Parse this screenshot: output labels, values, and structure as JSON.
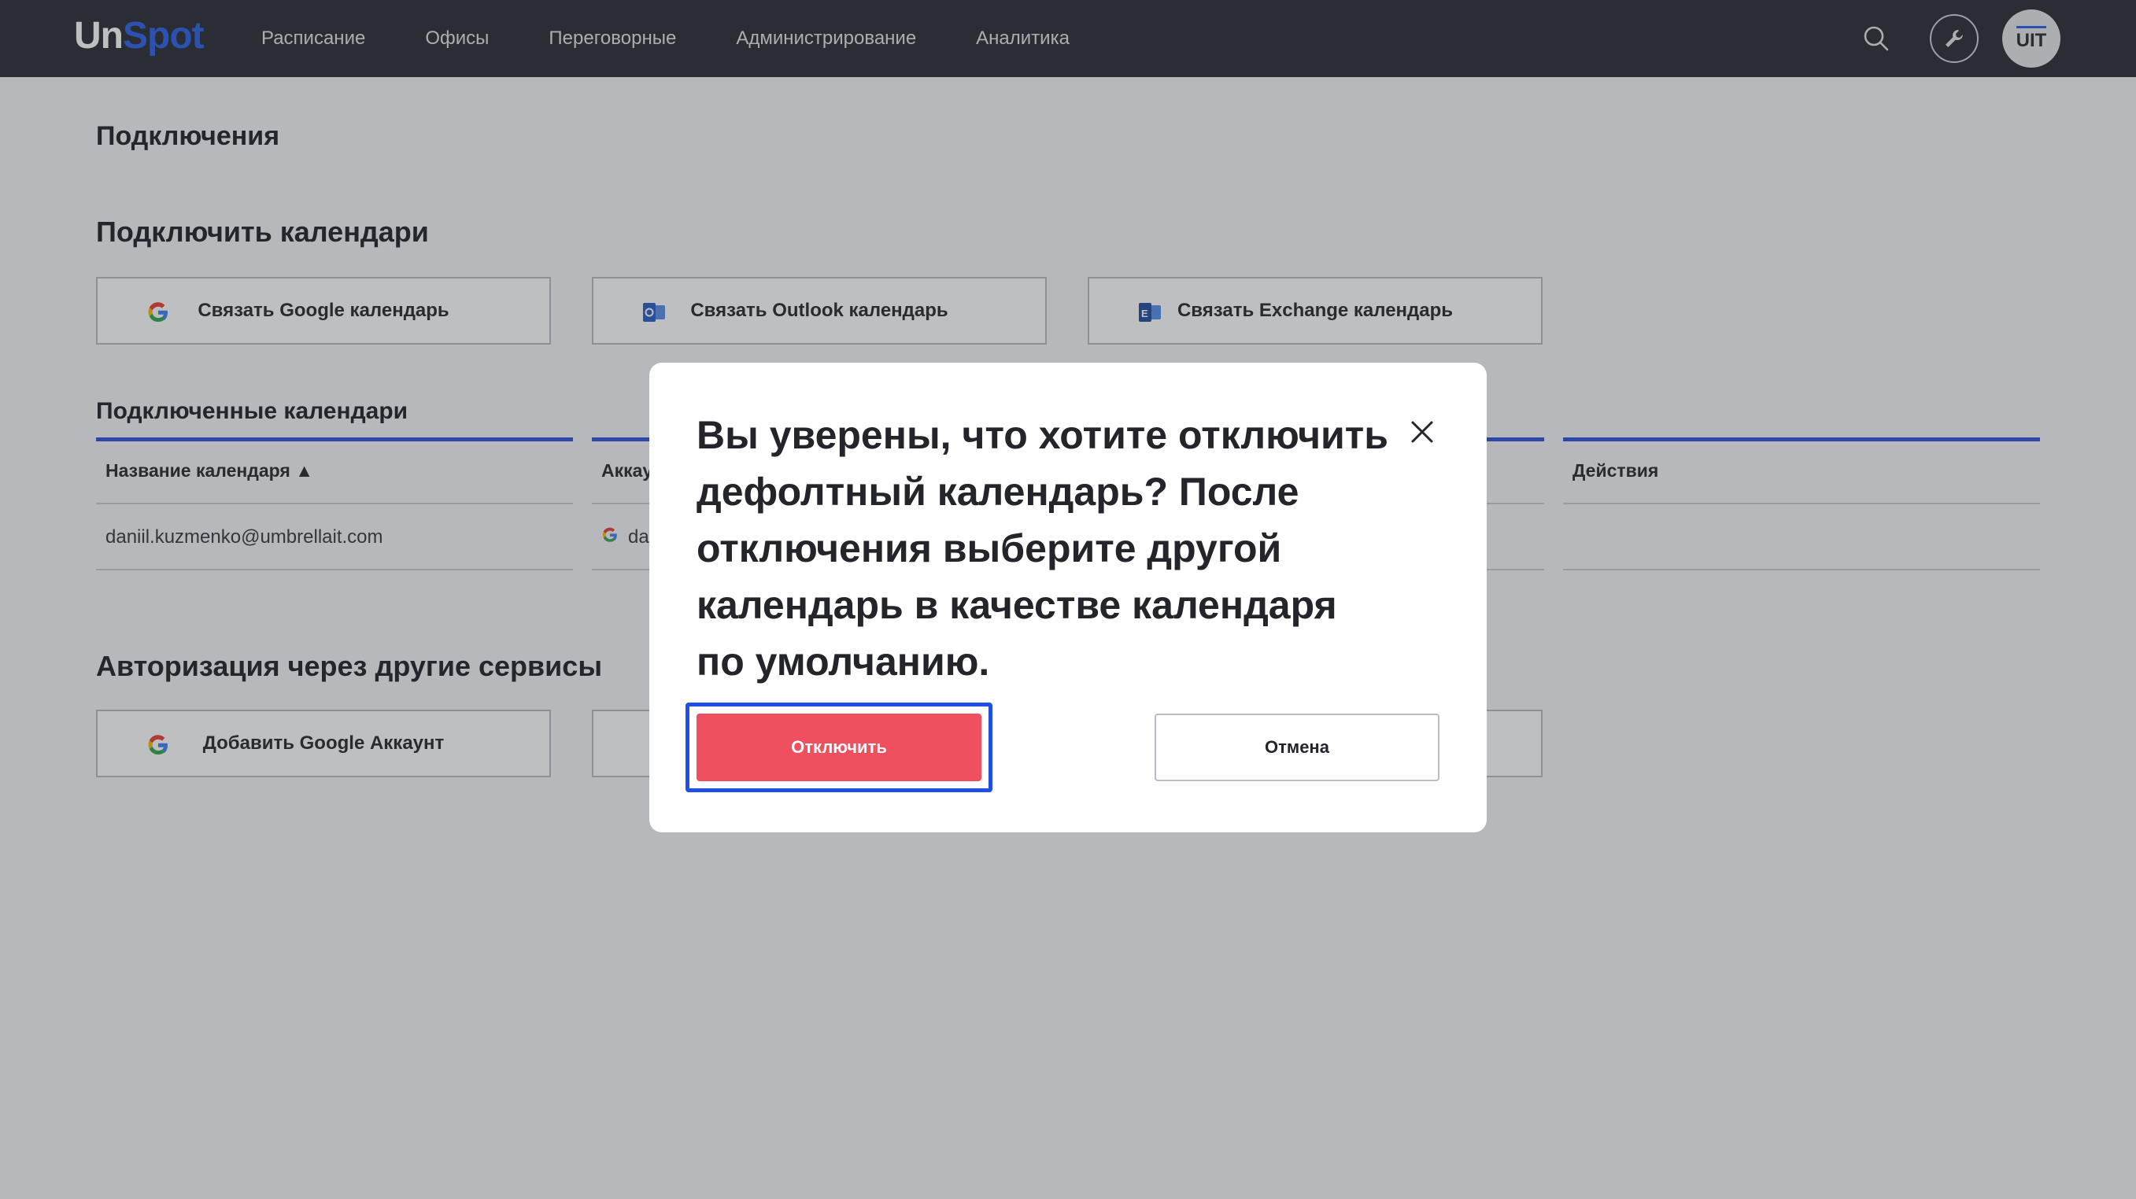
{
  "header": {
    "logo_un": "Un",
    "logo_spot": "Spot",
    "nav": [
      "Расписание",
      "Офисы",
      "Переговорные",
      "Администрирование",
      "Аналитика"
    ],
    "avatar_initials": "UIT"
  },
  "page": {
    "title": "Подключения",
    "connect_calendars": {
      "title": "Подключить календари",
      "buttons": [
        "Связать Google календарь",
        "Связать Outlook календарь",
        "Связать Exchange календарь"
      ]
    },
    "connected": {
      "title": "Подключенные календари",
      "columns": [
        "Название календаря ▲",
        "Аккау",
        "Действия"
      ],
      "row": {
        "name": "daniil.kuzmenko@umbrellait.com",
        "account": "dar"
      }
    },
    "auth": {
      "title": "Авторизация через другие сервисы",
      "buttons": [
        "Добавить Google Аккаунт"
      ]
    }
  },
  "modal": {
    "message": "Вы уверены, что хотите отключить дефолтный календарь? После отключения выберите другой календарь в качестве календаря по умолчанию.",
    "confirm_label": "Отключить",
    "cancel_label": "Отмена"
  },
  "colors": {
    "accent": "#2e55d8",
    "danger": "#ef4f5e",
    "topbar": "#2b2e35"
  }
}
